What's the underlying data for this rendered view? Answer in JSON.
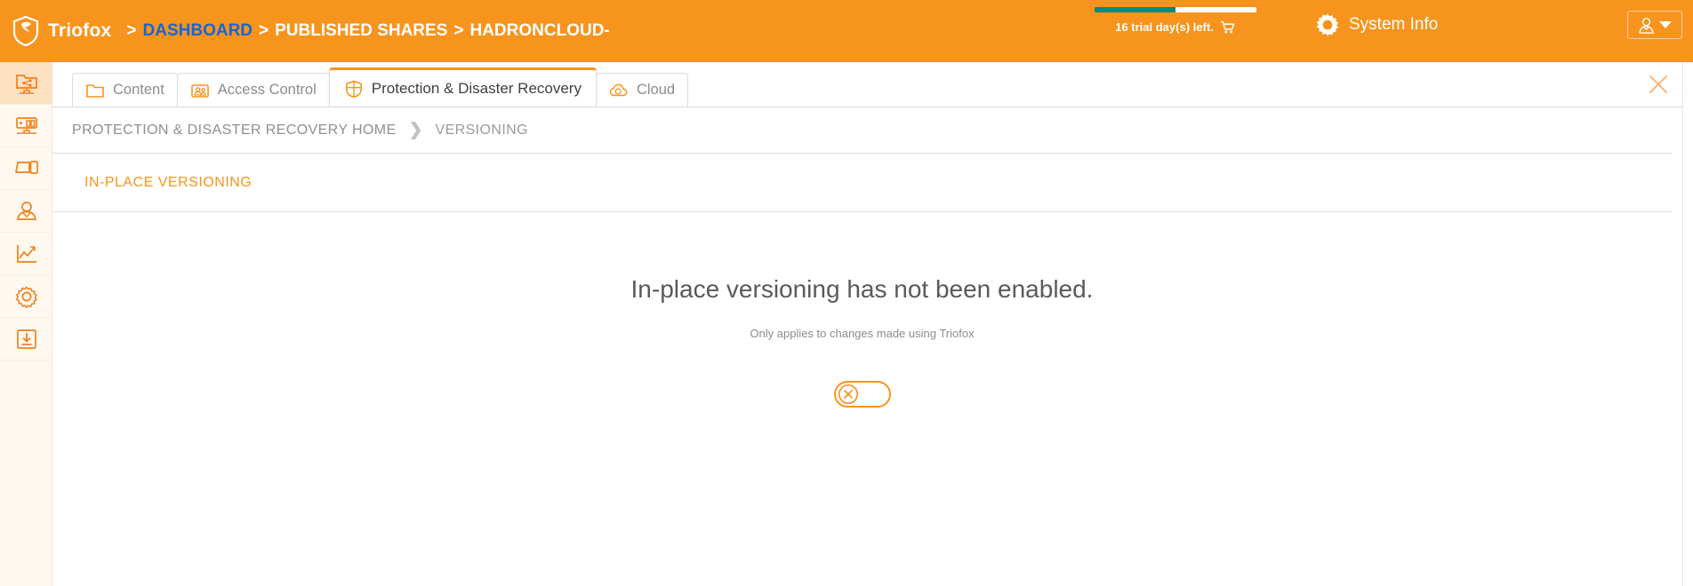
{
  "topbar": {
    "brand": "Triofox",
    "logo_icon": "shield-logo",
    "breadcrumb_sep": ">",
    "breadcrumbs": [
      {
        "label": "DASHBOARD",
        "kind": "link"
      },
      {
        "label": "PUBLISHED SHARES",
        "kind": "text"
      },
      {
        "label": "HADRONCLOUD-",
        "kind": "text"
      }
    ],
    "trial": {
      "text": "16 trial day(s) left.",
      "cart_icon": "shopping-cart-icon",
      "progress_percent": 50,
      "fill_color": "#00897b",
      "track_color": "#ffffff"
    },
    "system_info": {
      "label": "System Info",
      "icon": "gear-icon"
    },
    "user_menu": {
      "icon": "user-icon",
      "chevron": "chevron-down-icon"
    },
    "background_color": "#f7941e",
    "link_color": "#1565d8"
  },
  "sidebar": {
    "items": [
      {
        "name": "shared-folder-icon",
        "active": true
      },
      {
        "name": "server-icon",
        "active": false
      },
      {
        "name": "devices-icon",
        "active": false
      },
      {
        "name": "user-icon",
        "active": false
      },
      {
        "name": "analytics-chart-icon",
        "active": false
      },
      {
        "name": "gear-icon",
        "active": false
      },
      {
        "name": "download-icon",
        "active": false
      }
    ],
    "active_background": "#fbe0c2",
    "background": "#fff8f1"
  },
  "tabs": [
    {
      "label": "Content",
      "icon": "folder-icon",
      "active": false
    },
    {
      "label": "Access Control",
      "icon": "user-card-icon",
      "active": false
    },
    {
      "label": "Protection & Disaster Recovery",
      "icon": "shield-grid-icon",
      "active": true
    },
    {
      "label": "Cloud",
      "icon": "cloud-sync-icon",
      "active": false
    }
  ],
  "close_button": {
    "icon": "close-icon",
    "color": "#f8b77a"
  },
  "breadcrumb": {
    "items": [
      "PROTECTION & DISASTER RECOVERY HOME",
      "VERSIONING"
    ],
    "separator": "❯"
  },
  "section": {
    "title": "IN-PLACE VERSIONING",
    "accent_color": "#f7941e"
  },
  "empty_state": {
    "headline": "In-place versioning has not been enabled.",
    "subtext": "Only applies to changes made using Triofox",
    "toggle": {
      "state": "off",
      "knob_icon": "x-circle-icon",
      "accent_color": "#f7941e"
    }
  }
}
